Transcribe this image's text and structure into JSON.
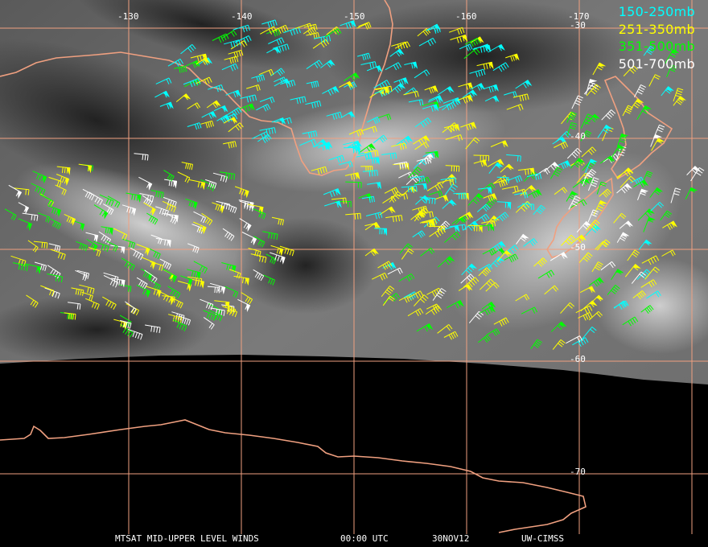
{
  "legend": [
    {
      "label": "150-250mb",
      "color": "#00ffff"
    },
    {
      "label": "251-350mb",
      "color": "#ffff00"
    },
    {
      "label": "351-500mb",
      "color": "#00ff00"
    },
    {
      "label": "501-700mb",
      "color": "#ffffff"
    }
  ],
  "grid": {
    "color": "#f0a080",
    "longitude_labels": [
      "-130",
      "-140",
      "-150",
      "-160",
      "-170"
    ],
    "latitude_labels": [
      "-30",
      "-40",
      "-50",
      "-60",
      "-70"
    ]
  },
  "colors": {
    "coastline": "#f0a080",
    "space": "#000000",
    "water_vapor_base": "#707070"
  },
  "footer": {
    "product": "MTSAT MID-UPPER LEVEL WINDS",
    "time": "00:00 UTC",
    "date": "30NOV12",
    "source": "UW-CIMSS"
  }
}
